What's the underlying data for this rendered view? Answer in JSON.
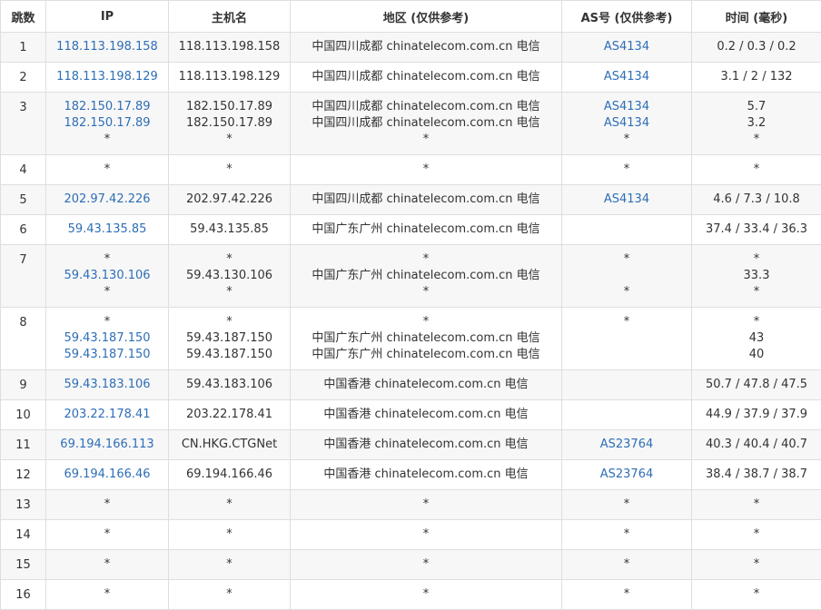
{
  "headers": {
    "hop": "跳数",
    "ip": "IP",
    "host": "主机名",
    "region": "地区 (仅供参考)",
    "as": "AS号 (仅供参考)",
    "time": "时间 (毫秒)"
  },
  "colors": {
    "link": "#2e6eb7",
    "border": "#dedede",
    "row_alt": "#f7f7f7"
  },
  "rows": [
    {
      "hop": "1",
      "ip": [
        "118.113.198.158"
      ],
      "host": [
        "118.113.198.158"
      ],
      "region": [
        "中国四川成都 chinatelecom.com.cn 电信"
      ],
      "as": [
        "AS4134"
      ],
      "time": [
        "0.2 / 0.3 / 0.2"
      ]
    },
    {
      "hop": "2",
      "ip": [
        "118.113.198.129"
      ],
      "host": [
        "118.113.198.129"
      ],
      "region": [
        "中国四川成都 chinatelecom.com.cn 电信"
      ],
      "as": [
        "AS4134"
      ],
      "time": [
        "3.1 / 2 / 132"
      ]
    },
    {
      "hop": "3",
      "ip": [
        "182.150.17.89",
        "182.150.17.89",
        "*"
      ],
      "host": [
        "182.150.17.89",
        "182.150.17.89",
        "*"
      ],
      "region": [
        "中国四川成都 chinatelecom.com.cn 电信",
        "中国四川成都 chinatelecom.com.cn 电信",
        "*"
      ],
      "as": [
        "AS4134",
        "AS4134",
        "*"
      ],
      "time": [
        "5.7",
        "3.2",
        "*"
      ]
    },
    {
      "hop": "4",
      "ip": [
        "*"
      ],
      "host": [
        "*"
      ],
      "region": [
        "*"
      ],
      "as": [
        "*"
      ],
      "time": [
        "*"
      ]
    },
    {
      "hop": "5",
      "ip": [
        "202.97.42.226"
      ],
      "host": [
        "202.97.42.226"
      ],
      "region": [
        "中国四川成都 chinatelecom.com.cn 电信"
      ],
      "as": [
        "AS4134"
      ],
      "time": [
        "4.6 / 7.3 / 10.8"
      ]
    },
    {
      "hop": "6",
      "ip": [
        "59.43.135.85"
      ],
      "host": [
        "59.43.135.85"
      ],
      "region": [
        "中国广东广州 chinatelecom.com.cn 电信"
      ],
      "as": [
        ""
      ],
      "time": [
        "37.4 / 33.4 / 36.3"
      ]
    },
    {
      "hop": "7",
      "ip": [
        "*",
        "59.43.130.106",
        "*"
      ],
      "host": [
        "*",
        "59.43.130.106",
        "*"
      ],
      "region": [
        "*",
        "中国广东广州 chinatelecom.com.cn 电信",
        "*"
      ],
      "as": [
        "*",
        "",
        "*"
      ],
      "time": [
        "*",
        "33.3",
        "*"
      ]
    },
    {
      "hop": "8",
      "ip": [
        "*",
        "59.43.187.150",
        "59.43.187.150"
      ],
      "host": [
        "*",
        "59.43.187.150",
        "59.43.187.150"
      ],
      "region": [
        "*",
        "中国广东广州 chinatelecom.com.cn 电信",
        "中国广东广州 chinatelecom.com.cn 电信"
      ],
      "as": [
        "*",
        "",
        ""
      ],
      "time": [
        "*",
        "43",
        "40"
      ]
    },
    {
      "hop": "9",
      "ip": [
        "59.43.183.106"
      ],
      "host": [
        "59.43.183.106"
      ],
      "region": [
        "中国香港 chinatelecom.com.cn 电信"
      ],
      "as": [
        ""
      ],
      "time": [
        "50.7 / 47.8 / 47.5"
      ]
    },
    {
      "hop": "10",
      "ip": [
        "203.22.178.41"
      ],
      "host": [
        "203.22.178.41"
      ],
      "region": [
        "中国香港 chinatelecom.com.cn 电信"
      ],
      "as": [
        ""
      ],
      "time": [
        "44.9 / 37.9 / 37.9"
      ]
    },
    {
      "hop": "11",
      "ip": [
        "69.194.166.113"
      ],
      "host": [
        "CN.HKG.CTGNet"
      ],
      "region": [
        "中国香港 chinatelecom.com.cn 电信"
      ],
      "as": [
        "AS23764"
      ],
      "time": [
        "40.3 / 40.4 / 40.7"
      ]
    },
    {
      "hop": "12",
      "ip": [
        "69.194.166.46"
      ],
      "host": [
        "69.194.166.46"
      ],
      "region": [
        "中国香港 chinatelecom.com.cn 电信"
      ],
      "as": [
        "AS23764"
      ],
      "time": [
        "38.4 / 38.7 / 38.7"
      ]
    },
    {
      "hop": "13",
      "ip": [
        "*"
      ],
      "host": [
        "*"
      ],
      "region": [
        "*"
      ],
      "as": [
        "*"
      ],
      "time": [
        "*"
      ]
    },
    {
      "hop": "14",
      "ip": [
        "*"
      ],
      "host": [
        "*"
      ],
      "region": [
        "*"
      ],
      "as": [
        "*"
      ],
      "time": [
        "*"
      ]
    },
    {
      "hop": "15",
      "ip": [
        "*"
      ],
      "host": [
        "*"
      ],
      "region": [
        "*"
      ],
      "as": [
        "*"
      ],
      "time": [
        "*"
      ]
    },
    {
      "hop": "16",
      "ip": [
        "*"
      ],
      "host": [
        "*"
      ],
      "region": [
        "*"
      ],
      "as": [
        "*"
      ],
      "time": [
        "*"
      ]
    }
  ]
}
